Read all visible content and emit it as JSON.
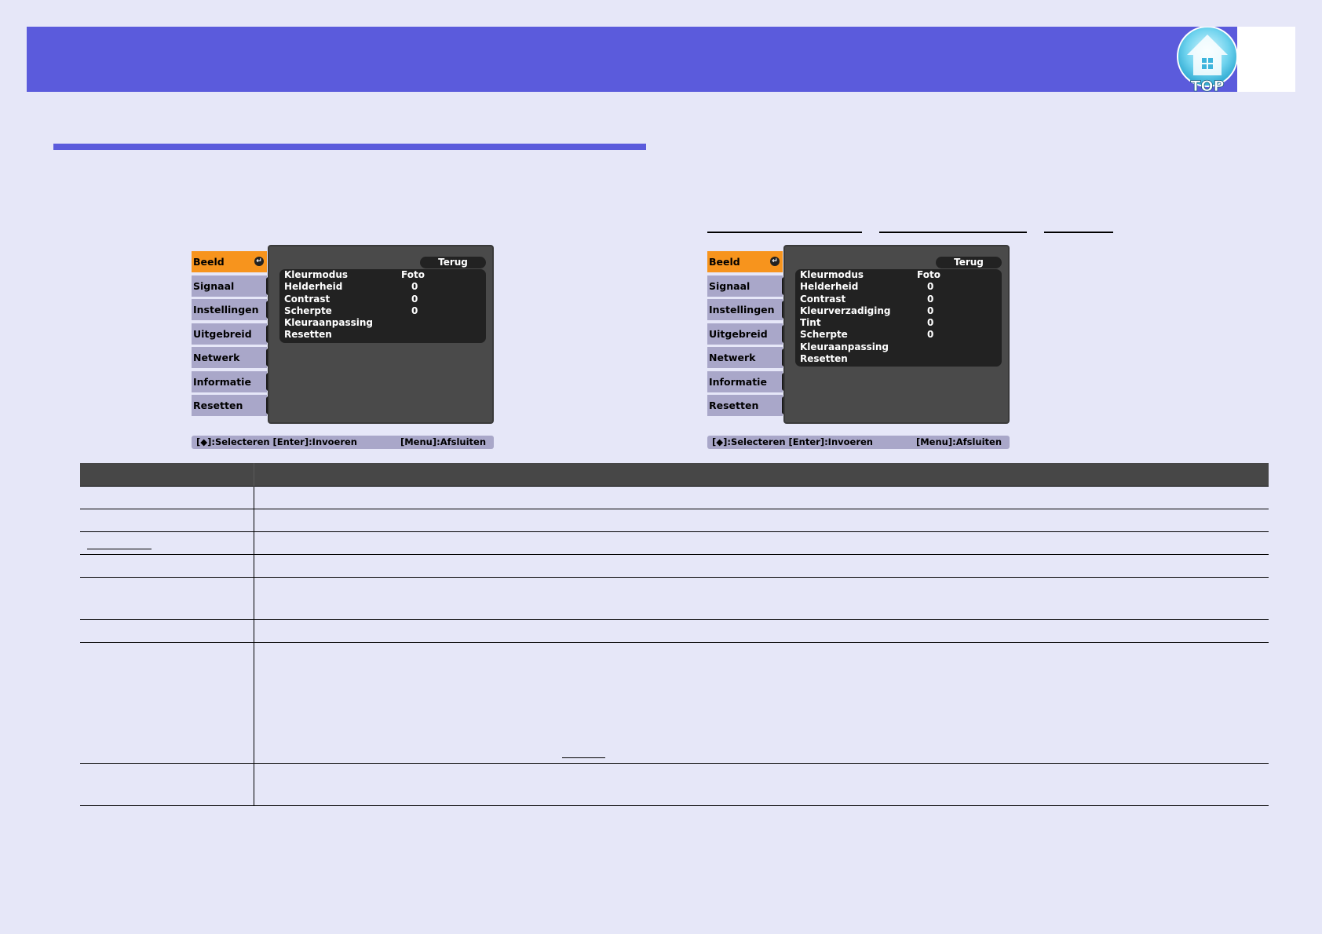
{
  "header": {
    "top_button_label": "TOP"
  },
  "menus": [
    {
      "tabs": [
        "Beeld",
        "Signaal",
        "Instellingen",
        "Uitgebreid",
        "Netwerk",
        "Informatie",
        "Resetten"
      ],
      "active_tab": "Beeld",
      "back_label": "Terug",
      "rows": [
        {
          "label": "Kleurmodus",
          "value": "Foto"
        },
        {
          "label": "Helderheid",
          "value": "0"
        },
        {
          "label": "Contrast",
          "value": "0"
        },
        {
          "label": "Scherpte",
          "value": "0"
        },
        {
          "label": "Kleuraanpassing",
          "value": ""
        },
        {
          "label": "Resetten",
          "value": ""
        }
      ],
      "status_left": "[◆]:Selecteren [Enter]:Invoeren",
      "status_right": "[Menu]:Afsluiten"
    },
    {
      "tabs": [
        "Beeld",
        "Signaal",
        "Instellingen",
        "Uitgebreid",
        "Netwerk",
        "Informatie",
        "Resetten"
      ],
      "active_tab": "Beeld",
      "back_label": "Terug",
      "rows": [
        {
          "label": "Kleurmodus",
          "value": "Foto"
        },
        {
          "label": "Helderheid",
          "value": "0"
        },
        {
          "label": "Contrast",
          "value": "0"
        },
        {
          "label": "Kleurverzadiging",
          "value": "0"
        },
        {
          "label": "Tint",
          "value": "0"
        },
        {
          "label": "Scherpte",
          "value": "0"
        },
        {
          "label": "Kleuraanpassing",
          "value": ""
        },
        {
          "label": "Resetten",
          "value": ""
        }
      ],
      "status_left": "[◆]:Selecteren [Enter]:Invoeren",
      "status_right": "[Menu]:Afsluiten"
    }
  ],
  "colors": {
    "header": "#5b5bdc",
    "background": "#e6e7f8",
    "tab_active": "#f7941d",
    "tab_inactive": "#a9a7c9",
    "panel": "#4a4a4a",
    "table_header": "#474747"
  },
  "icons": [
    "top-home-icon",
    "enter-icon"
  ],
  "table": {
    "row_count": 8
  }
}
